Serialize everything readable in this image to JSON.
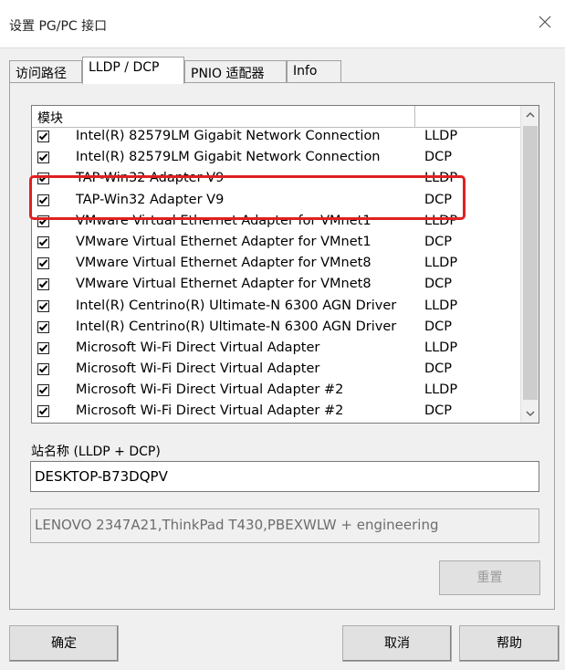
{
  "window": {
    "title": "设置 PG/PC 接口"
  },
  "tabs": [
    {
      "label": "访问路径"
    },
    {
      "label": "LLDP / DCP"
    },
    {
      "label": "PNIO 适配器"
    },
    {
      "label": "Info"
    }
  ],
  "active_tab": 1,
  "list": {
    "header_module": "模块",
    "rows": [
      {
        "name": "Intel(R) 82579LM Gigabit Network Connection",
        "proto": "LLDP",
        "checked": true
      },
      {
        "name": "Intel(R) 82579LM Gigabit Network Connection",
        "proto": "DCP",
        "checked": true
      },
      {
        "name": "TAP-Win32 Adapter V9",
        "proto": "LLDP",
        "checked": true
      },
      {
        "name": "TAP-Win32 Adapter V9",
        "proto": "DCP",
        "checked": true
      },
      {
        "name": "VMware Virtual Ethernet Adapter for VMnet1",
        "proto": "LLDP",
        "checked": true
      },
      {
        "name": "VMware Virtual Ethernet Adapter for VMnet1",
        "proto": "DCP",
        "checked": true
      },
      {
        "name": "VMware Virtual Ethernet Adapter for VMnet8",
        "proto": "LLDP",
        "checked": true
      },
      {
        "name": "VMware Virtual Ethernet Adapter for VMnet8",
        "proto": "DCP",
        "checked": true
      },
      {
        "name": "Intel(R) Centrino(R) Ultimate-N 6300 AGN Driver",
        "proto": "LLDP",
        "checked": true
      },
      {
        "name": "Intel(R) Centrino(R) Ultimate-N 6300 AGN Driver",
        "proto": "DCP",
        "checked": true
      },
      {
        "name": "Microsoft Wi-Fi Direct Virtual Adapter",
        "proto": "LLDP",
        "checked": true
      },
      {
        "name": "Microsoft Wi-Fi Direct Virtual Adapter",
        "proto": "DCP",
        "checked": true
      },
      {
        "name": "Microsoft Wi-Fi Direct Virtual Adapter #2",
        "proto": "LLDP",
        "checked": true
      },
      {
        "name": "Microsoft Wi-Fi Direct Virtual Adapter #2",
        "proto": "DCP",
        "checked": true
      }
    ]
  },
  "station": {
    "label": "站名称 (LLDP + DCP)",
    "value": "DESKTOP-B73DQPV"
  },
  "info_text": "LENOVO 2347A21,ThinkPad T430,PBEXWLW + engineering",
  "buttons": {
    "reset": "重置",
    "ok": "确定",
    "cancel": "取消",
    "help": "帮助"
  },
  "colors": {
    "highlight": "#e02020",
    "window_bg": "#f0f0f0"
  }
}
